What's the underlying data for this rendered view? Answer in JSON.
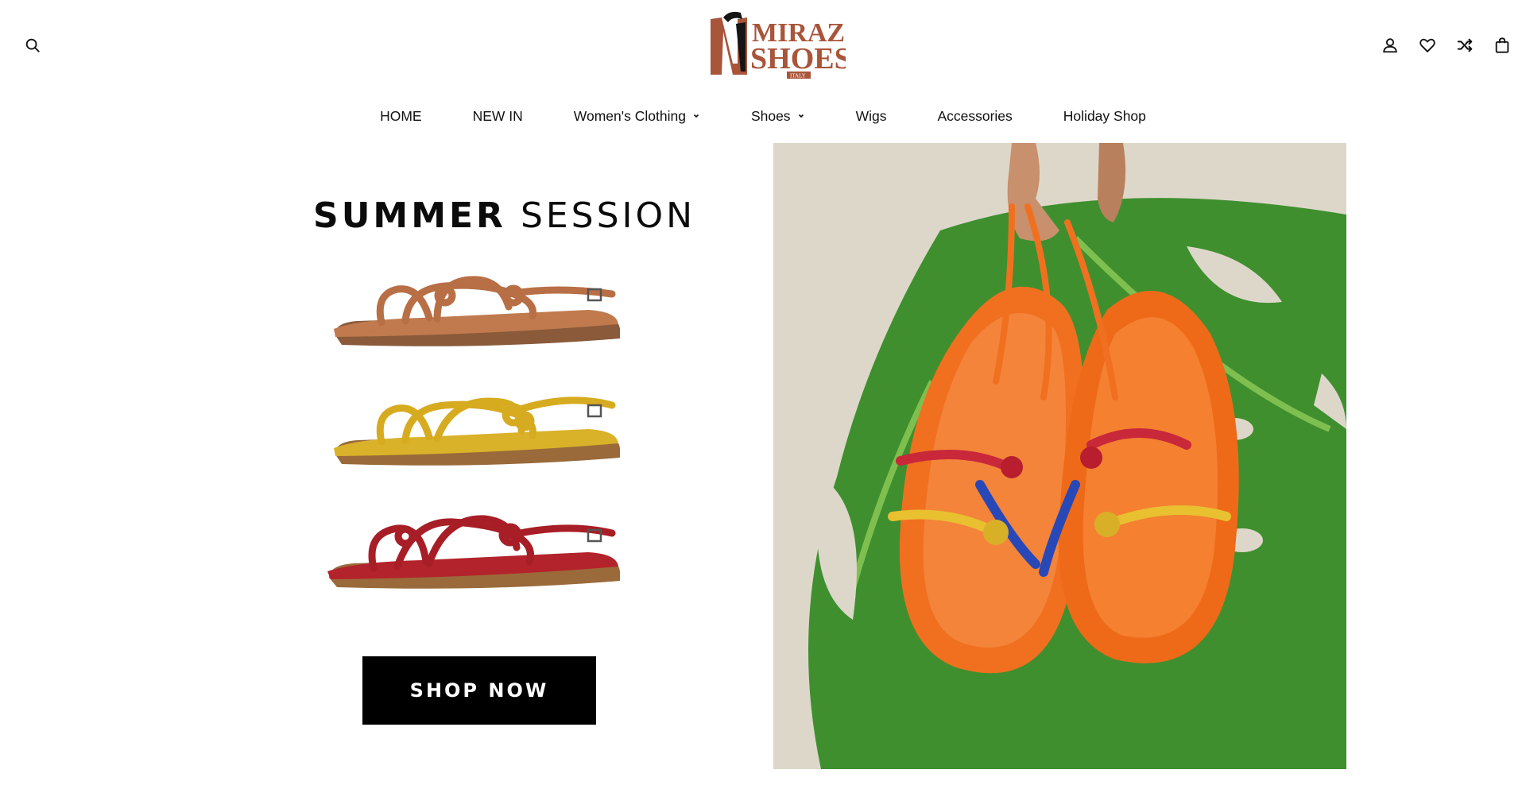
{
  "header": {
    "logo_text": [
      "MIRAZ",
      "SHOES",
      "ITALY"
    ],
    "icons": {
      "search": "search-icon",
      "account": "user-icon",
      "wishlist": "heart-icon",
      "compare": "shuffle-icon",
      "cart": "shopping-bag-icon"
    }
  },
  "nav": {
    "items": [
      {
        "label": "HOME",
        "has_dropdown": false
      },
      {
        "label": "NEW IN",
        "has_dropdown": false
      },
      {
        "label": "Women's Clothing",
        "has_dropdown": true
      },
      {
        "label": "Shoes",
        "has_dropdown": true
      },
      {
        "label": "Wigs",
        "has_dropdown": false
      },
      {
        "label": "Accessories",
        "has_dropdown": false
      },
      {
        "label": "Holiday Shop",
        "has_dropdown": false
      }
    ]
  },
  "promo": {
    "title_bold": "SUMMER",
    "title_light": "SESSION",
    "sandal_colors": [
      "#c07a4e",
      "#d9b22a",
      "#b3232b"
    ],
    "button_label": "SHOP NOW"
  },
  "colors": {
    "brand_brown": "#a8553a",
    "text": "#111111",
    "button_bg": "#000000",
    "hero_sandal": "#f07020",
    "leaf": "#3f8f2f"
  }
}
